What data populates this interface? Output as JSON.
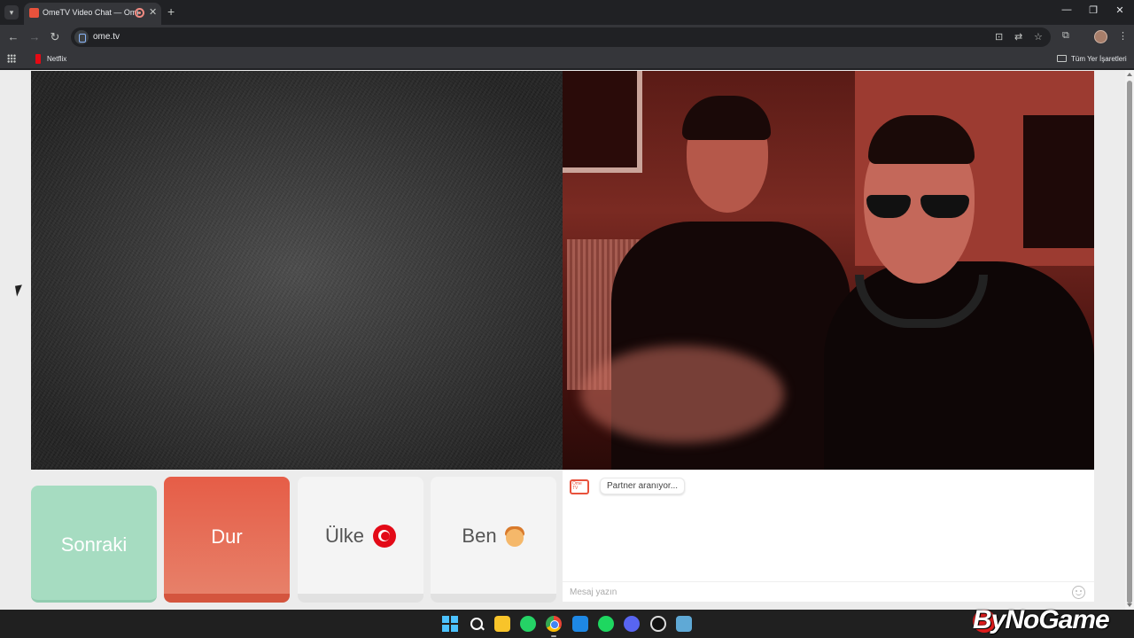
{
  "browser": {
    "tab_title": "OmeTV Video Chat — OmeTV",
    "tab_close": "✕",
    "new_tab": "+",
    "url": "ome.tv",
    "window_controls": {
      "minimize": "—",
      "restore": "❐",
      "close": "✕"
    }
  },
  "bookmarks": {
    "items": [
      {
        "label": "Netflix",
        "icon": "netflix-icon"
      }
    ],
    "all_bookmarks": "Tüm Yer İşaretleri"
  },
  "controls": {
    "next_label": "Sonraki",
    "stop_label": "Dur",
    "country_label": "Ülke",
    "country_flag": "turkey-flag-icon",
    "me_label": "Ben",
    "me_icon": "boy-emoji-icon"
  },
  "chat": {
    "logo_text": "Ome TV",
    "status_message": "Partner aranıyor...",
    "input_placeholder": "Mesaj yazın"
  },
  "colors": {
    "next_button": "#a6dcc1",
    "stop_button": "#e65d47",
    "neutral_button": "#f4f4f4",
    "page_background": "#ececec"
  },
  "taskbar": {
    "apps": [
      "windows-start-icon",
      "search-icon",
      "file-explorer-icon",
      "whatsapp-icon",
      "chrome-icon",
      "vscode-icon",
      "spotify-icon",
      "discord-icon",
      "obs-icon",
      "app-icon"
    ]
  },
  "watermark": "ByNoGame"
}
